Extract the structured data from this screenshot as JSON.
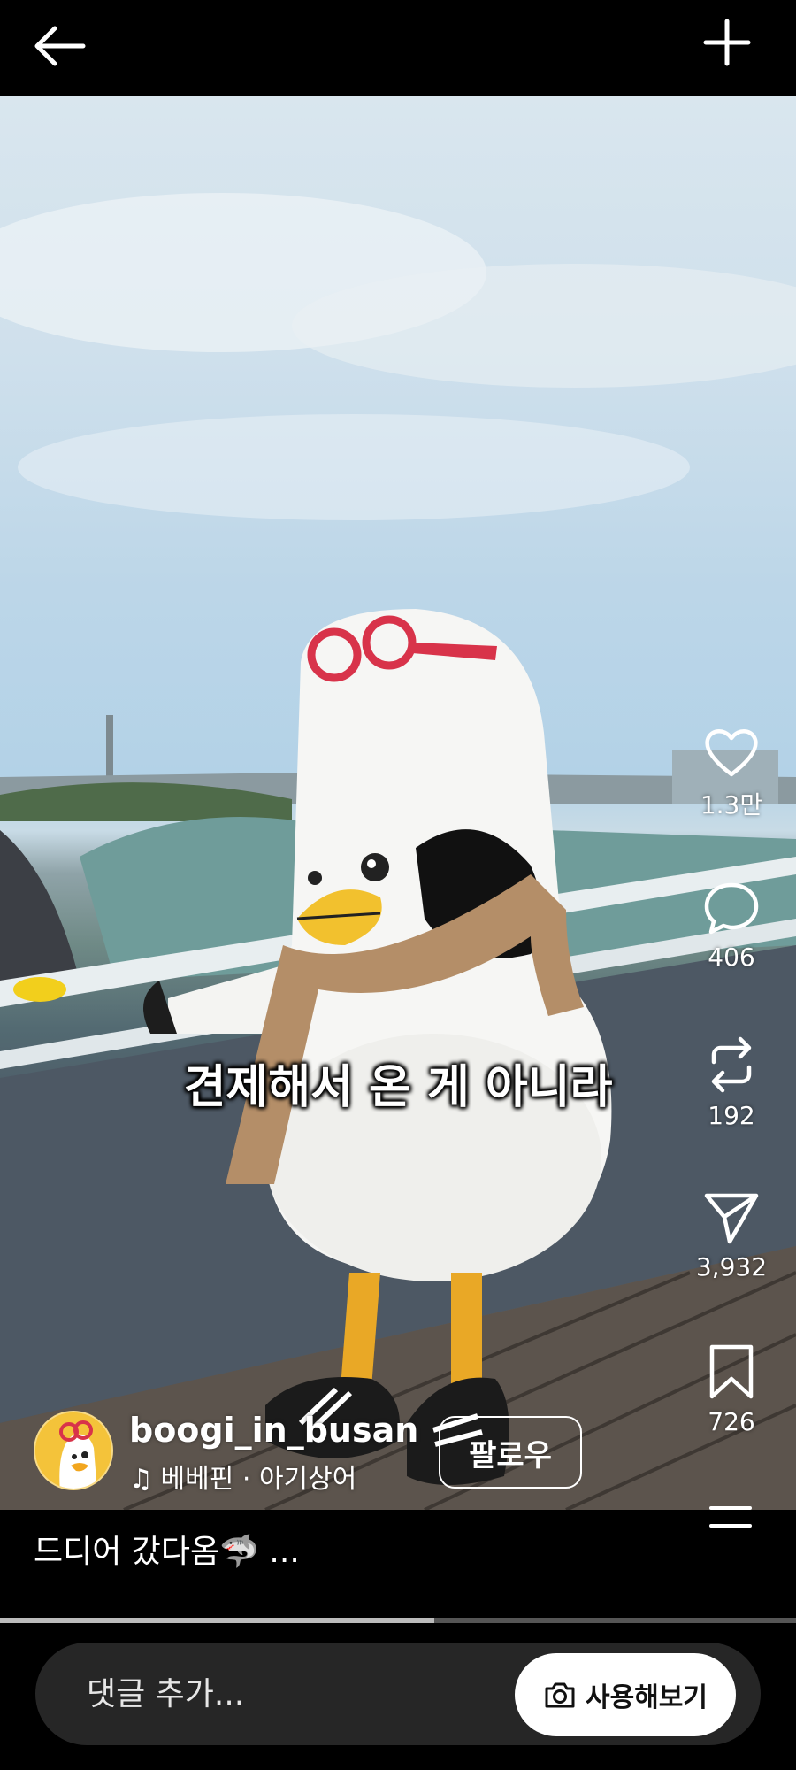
{
  "header": {
    "back_icon": "arrow-left-icon",
    "add_icon": "plus-icon"
  },
  "video": {
    "subtitle": "견제해서 온 게 아니라"
  },
  "actions": [
    {
      "icon": "heart-icon",
      "count": "1.3만"
    },
    {
      "icon": "comment-icon",
      "count": "406"
    },
    {
      "icon": "repost-icon",
      "count": "192"
    },
    {
      "icon": "share-icon",
      "count": "3,932"
    },
    {
      "icon": "bookmark-icon",
      "count": "726"
    }
  ],
  "author": {
    "username": "boogi_in_busan",
    "music": "베베핀 · 아기상어",
    "follow_label": "팔로우"
  },
  "caption": {
    "text": "드디어 갔다옴🦈 ..."
  },
  "progress": {
    "fraction": 0.545
  },
  "bottom": {
    "comment_placeholder": "댓글 추가...",
    "try_label": "사용해보기"
  },
  "colors": {
    "background": "#000000",
    "input_bg": "#262626",
    "button_bg": "#ffffff"
  }
}
